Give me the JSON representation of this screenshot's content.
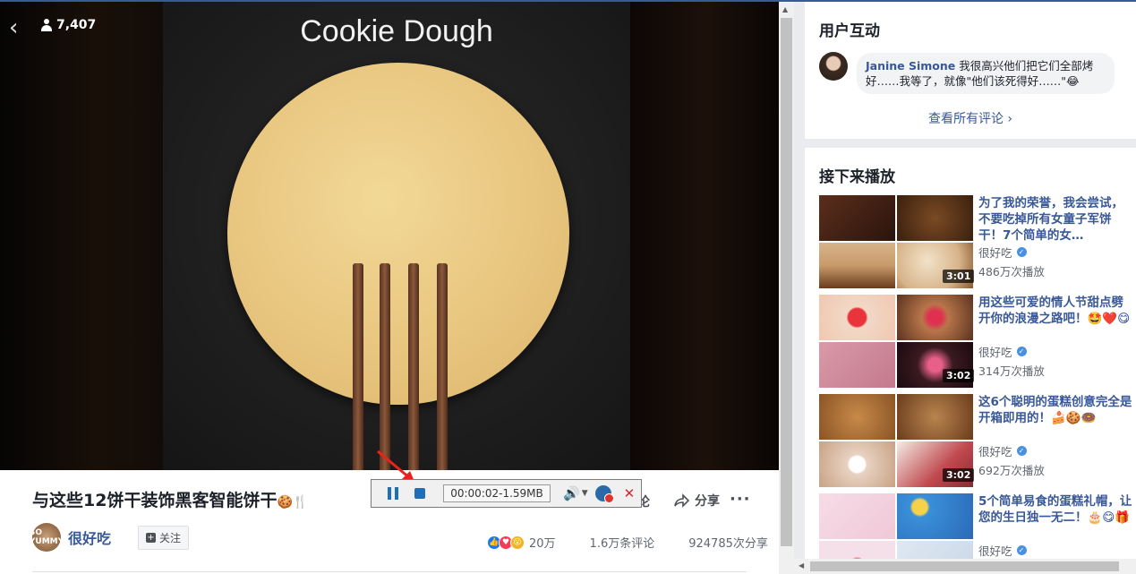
{
  "video": {
    "overlay_title": "Cookie Dough",
    "viewer_count": "7,407",
    "back_icon": "chevron-left-icon"
  },
  "post": {
    "title": "与这些12饼干装饰黑客智能饼干",
    "title_emojis": "🍪🍴",
    "page_name": "很好吃",
    "page_avatar_text": "SO YUMMY",
    "follow_label": "关注",
    "comment_label": "论",
    "share_label": "分享",
    "reaction_count": "20万",
    "comments_count": "1.6万条评论",
    "shares_count": "924785次分享"
  },
  "recorder": {
    "time_size": "00:00:02-1.59MB"
  },
  "interaction": {
    "heading": "用户互动",
    "comment": {
      "author": "Janine Simone",
      "text": "我很高兴他们把它们全部烤好……我等了，就像\"他们该死得好……\"😂"
    },
    "see_all": "查看所有评论"
  },
  "up_next": {
    "heading": "接下来播放",
    "items": [
      {
        "title": "为了我的荣誉，我会尝试，不要吃掉所有女童子军饼干！7个简单的女…",
        "channel": "很好吃",
        "views": "486万次播放",
        "duration": "3:01",
        "colors": [
          "#5b2e1c",
          "#7a4a24",
          "#c89a6a",
          "#d7b48a"
        ]
      },
      {
        "title": "用这些可爱的情人节甜点劈开你的浪漫之路吧！🤩❤️😋",
        "channel": "很好吃",
        "views": "314万次播放",
        "duration": "3:02",
        "colors": [
          "#f2d8c7",
          "#b8754a",
          "#d99aa8",
          "#3a1a20"
        ]
      },
      {
        "title": "这6个聪明的蛋糕创意完全是开箱即用的！🍰🍪🍩",
        "channel": "很好吃",
        "views": "692万次播放",
        "duration": "3:02",
        "colors": [
          "#b07a3e",
          "#a86a34",
          "#e8d2c2",
          "#c04a50"
        ]
      },
      {
        "title": "5个简单易食的蛋糕礼帽，让您的生日独一无二！🎂😋🎁",
        "channel": "很好吃",
        "views": "",
        "duration": "",
        "colors": [
          "#f0c8d8",
          "#3a8fd8",
          "#f5e0ea",
          "#dfe8f2"
        ]
      }
    ]
  }
}
